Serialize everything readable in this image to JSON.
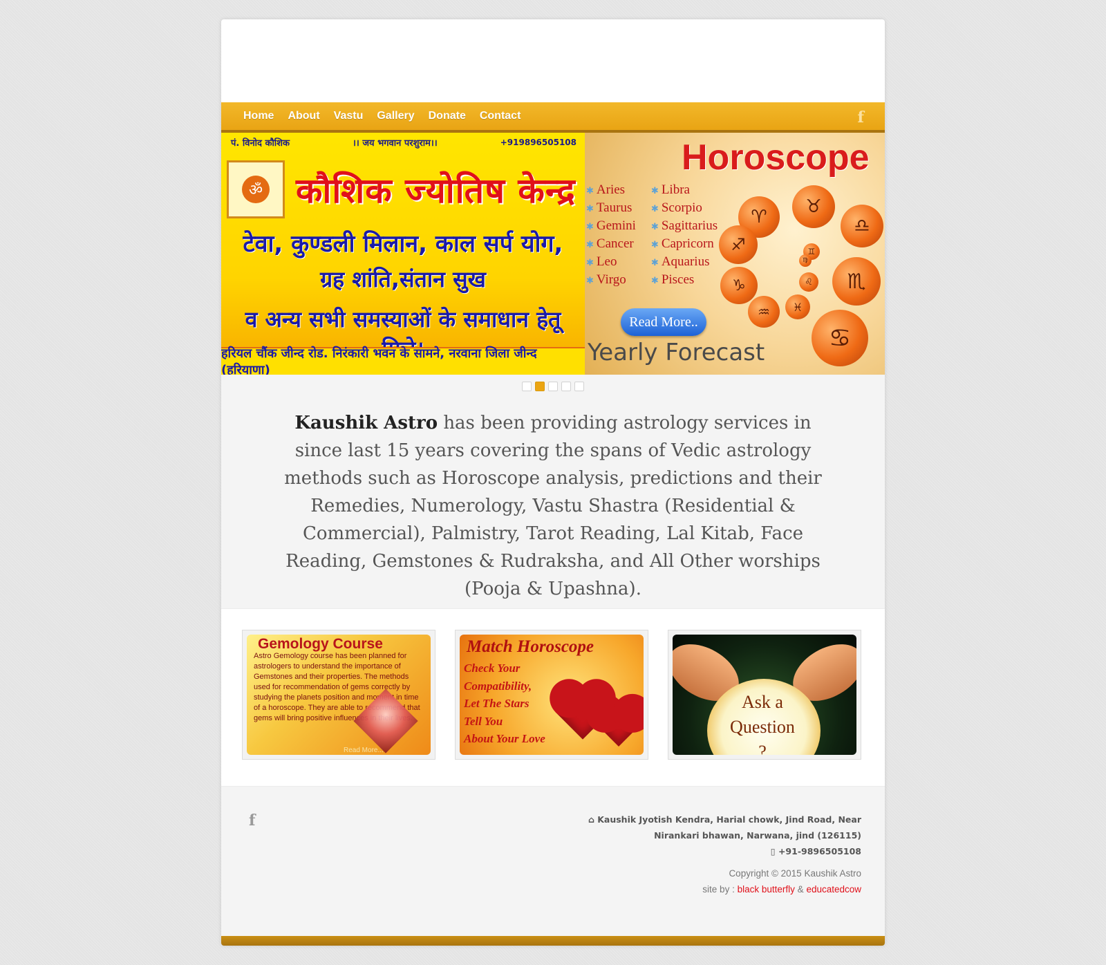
{
  "nav": {
    "items": [
      "Home",
      "About",
      "Vastu",
      "Gallery",
      "Donate",
      "Contact"
    ],
    "facebook_icon": "facebook-icon"
  },
  "slider": {
    "left_banner": {
      "top_left": "पं. विनोद कौशिक",
      "top_center": "।। जय भगवान परशुराम।।",
      "phone": "+919896505108",
      "title": "कौशिक ज्योतिष केन्द्र",
      "line1": "टेवा, कुण्डली मिलान, काल सर्प योग,",
      "line2": "ग्रह शांति,संतान सुख",
      "line3": "व अन्य सभी समस्याओं के समाधान हेतू मिले।",
      "bottom": "हरियल चौंक जीन्द रोड. निरंकारी भवन के सामने, नरवाना जिला जीन्द (हरियाणा)"
    },
    "right_banner": {
      "title": "Horoscope",
      "signs_col1": [
        "Aries",
        "Taurus",
        "Gemini",
        "Cancer",
        "Leo",
        "Virgo"
      ],
      "signs_col2": [
        "Libra",
        "Scorpio",
        "Sagittarius",
        "Capricorn",
        "Aquarius",
        "Pisces"
      ],
      "read_more": "Read More..",
      "forecast": "Yearly Forecast"
    },
    "dots_total": 5,
    "dots_active_index": 1
  },
  "intro": {
    "brand": "Kaushik Astro",
    "text": "has been providing astrology services in since last 15 years covering the spans of Vedic astrology methods such as Horoscope analysis, predictions and their Remedies, Numerology, Vastu Shastra (Residential & Commercial), Palmistry, Tarot Reading, Lal Kitab, Face Reading, Gemstones & Rudraksha, and All Other worships (Pooja & Upashna)."
  },
  "cards": {
    "gemology": {
      "title": "Gemology Course",
      "text": "Astro Gemology course has been planned for astrologers to understand the importance of Gemstones and their properties. The methods used for recommendation of gems correctly by studying the planets position and moment in time of a horoscope. They are able to recommend that gems will bring positive influences in their lives.",
      "more": "Read More..."
    },
    "match": {
      "title": "Match Horoscope",
      "lines": [
        "Check Your",
        "Compatibility,",
        "Let The Stars",
        "Tell You",
        "About Your Love"
      ]
    },
    "ask": {
      "line1": "Ask a",
      "line2": "Question",
      "line3": "?"
    }
  },
  "footer": {
    "address_line1": "Kaushik Jyotish Kendra, Harial chowk, Jind Road, Near",
    "address_line2": "Nirankari bhawan, Narwana, jind (126115)",
    "phone": "+91-9896505108",
    "copyright": "Copyright © 2015 Kaushik Astro",
    "site_by": "site by :",
    "credit1": "black butterfly",
    "amp": "&",
    "credit2": "educatedcow",
    "home_icon": "home-icon",
    "phone_icon": "phone-icon"
  },
  "colors": {
    "nav_bg": "#e9a414",
    "accent_red": "#e0101a",
    "bottom_bar": "#a97410"
  }
}
